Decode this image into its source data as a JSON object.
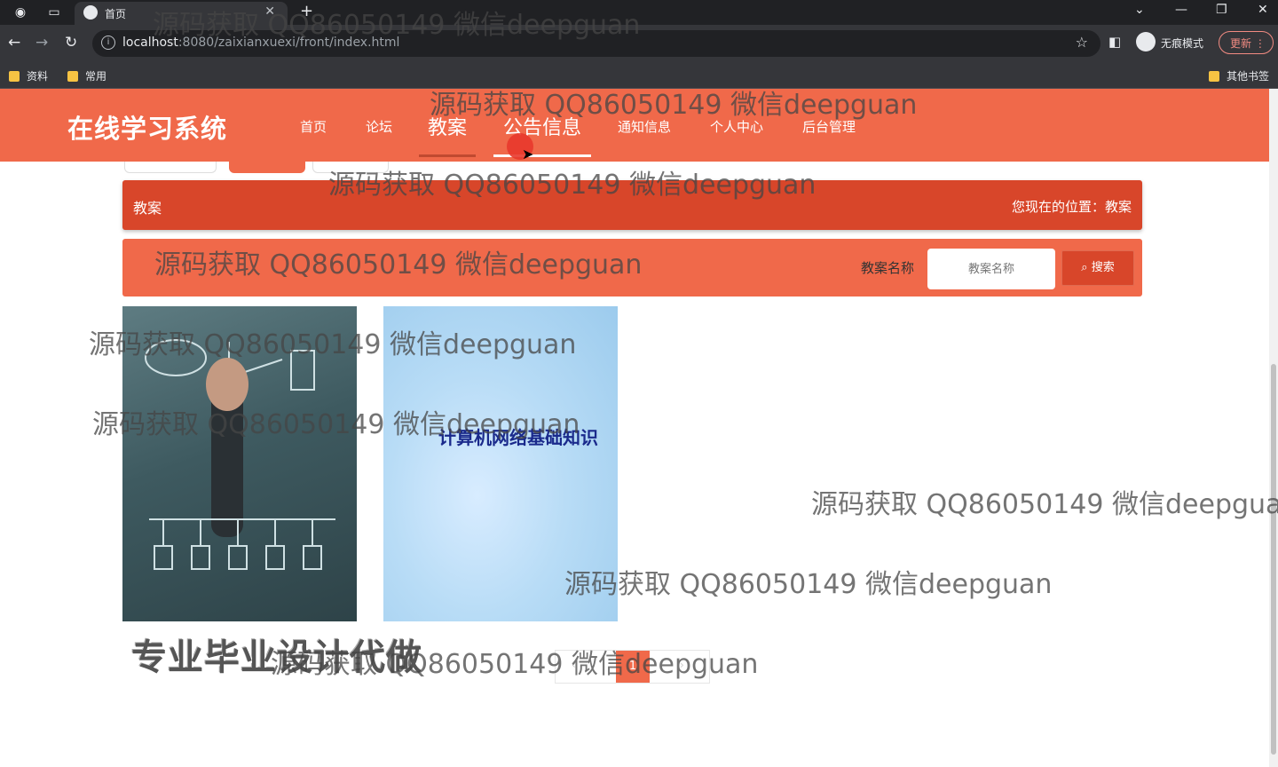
{
  "browser": {
    "tab_title": "首页",
    "url_host": "localhost",
    "url_path": ":8080/zaixianxuexi/front/index.html",
    "incognito_label": "无痕模式",
    "update_label": "更新",
    "bookmarks": [
      "资料",
      "常用"
    ],
    "other_bookmarks": "其他书签"
  },
  "header": {
    "logo": "在线学习系统",
    "menu": [
      "首页",
      "论坛",
      "教案",
      "公告信息",
      "通知信息",
      "个人中心",
      "后台管理"
    ]
  },
  "breadcrumb": {
    "title": "教案",
    "position_label": "您现在的位置：教案"
  },
  "search": {
    "label": "教案名称",
    "placeholder": "教案名称",
    "button": "搜索"
  },
  "cards": [
    {
      "image": "network-diagram-photo"
    },
    {
      "image_text": "计算机网络基础知识"
    }
  ],
  "pagination": {
    "current": "1"
  },
  "promo": "专业毕业设计代做",
  "watermark": "源码获取 QQ86050149 微信deepguan",
  "colors": {
    "accent": "#f0694a",
    "accent_dark": "#d8462a",
    "chrome": "#35363a"
  }
}
